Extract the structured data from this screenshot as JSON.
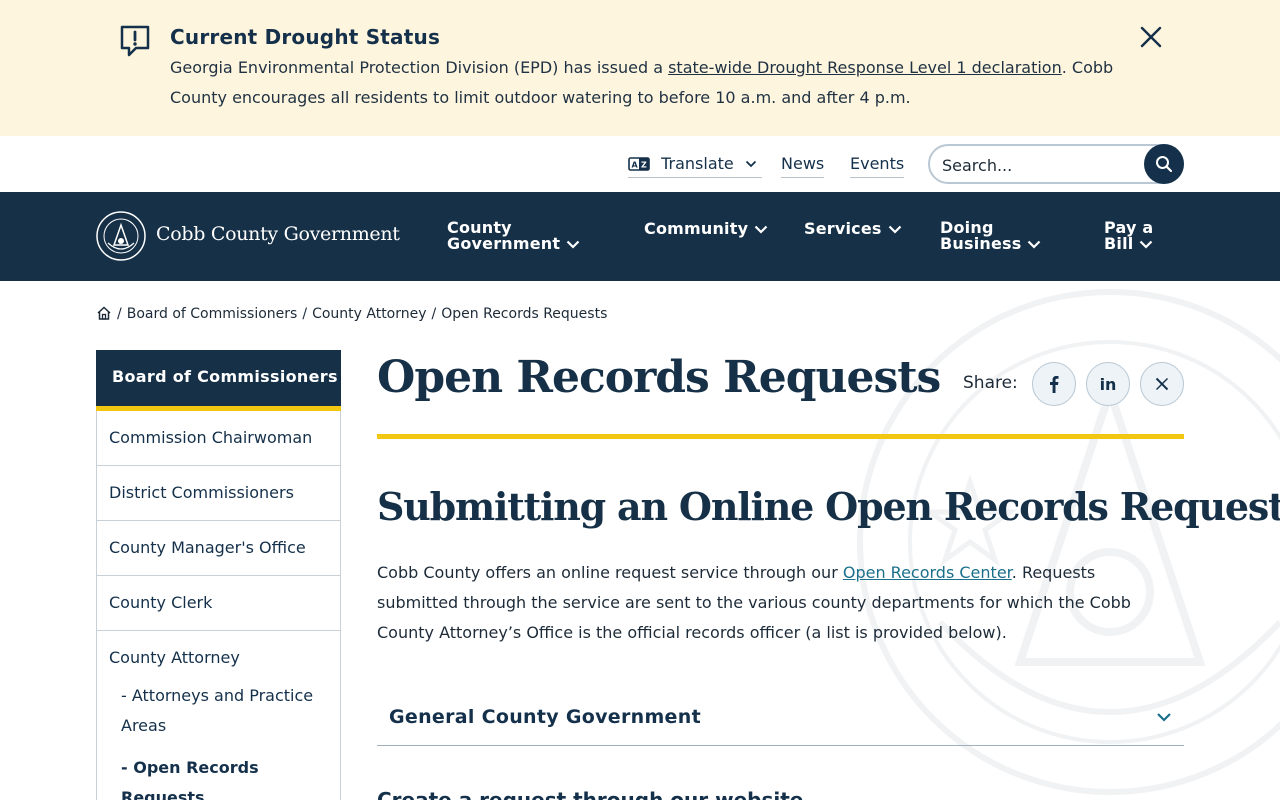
{
  "alert": {
    "title": "Current Drought Status",
    "text_before": "Georgia Environmental Protection Division (EPD) has issued a ",
    "link": "state-wide Drought Response Level 1 declaration",
    "text_after": ". Cobb County encourages all residents to limit outdoor watering to before 10 a.m. and after 4 p.m."
  },
  "utility": {
    "translate": "Translate",
    "news": "News",
    "events": "Events",
    "search_placeholder": "Search..."
  },
  "logo": {
    "text": "Cobb County Government"
  },
  "nav": [
    {
      "label_line1": "County",
      "label_line2": "Government"
    },
    {
      "label_line1": "Community",
      "label_line2": ""
    },
    {
      "label_line1": "Services",
      "label_line2": ""
    },
    {
      "label_line1": "Doing",
      "label_line2": "Business"
    },
    {
      "label_line1": "Pay a",
      "label_line2": "Bill"
    }
  ],
  "breadcrumb": [
    "Board of Commissioners",
    "County Attorney",
    "Open Records Requests"
  ],
  "sidebar": {
    "heading": "Board of Commissioners",
    "items": [
      "Commission Chairwoman",
      "District Commissioners",
      "County Manager's Office",
      "County Clerk",
      "County Attorney"
    ],
    "subitems": [
      "- Attorneys and Practice Areas",
      "- Open Records Requests"
    ]
  },
  "page": {
    "title": "Open Records Requests",
    "share_label": "Share:",
    "share_buttons": [
      "facebook",
      "linkedin",
      "x"
    ],
    "section_title": "Submitting an Online Open Records Request",
    "intro_before": "Cobb County offers an online request service through our ",
    "intro_link": "Open Records Center",
    "intro_after": ". Requests submitted through the service are sent to the various county departments for which the Cobb County Attorney’s Office is the official records officer (a list is provided below).",
    "accordion_label": "General County Government",
    "next_heading": "Create a request through our website"
  },
  "colors": {
    "navy": "#163047",
    "accent_yellow": "#f2c711",
    "alert_bg": "#fdf5de",
    "link": "#1a6f8a"
  }
}
